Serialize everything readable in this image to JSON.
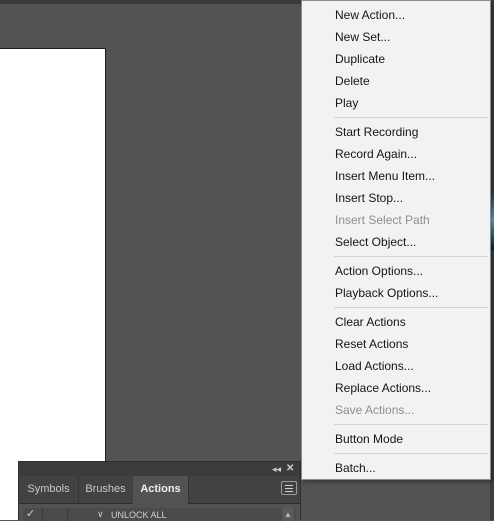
{
  "panel": {
    "tabs": [
      {
        "label": "Symbols"
      },
      {
        "label": "Brushes"
      },
      {
        "label": "Actions",
        "active": true
      }
    ],
    "action_row": {
      "label": "UNLOCK ALL",
      "checked": true
    }
  },
  "menu": {
    "items": [
      {
        "label": "New Action...",
        "enabled": true
      },
      {
        "label": "New Set...",
        "enabled": true
      },
      {
        "label": "Duplicate",
        "enabled": true
      },
      {
        "label": "Delete",
        "enabled": true
      },
      {
        "label": "Play",
        "enabled": true
      },
      {
        "label": "Start Recording",
        "enabled": true
      },
      {
        "label": "Record Again...",
        "enabled": true
      },
      {
        "label": "Insert Menu Item...",
        "enabled": true
      },
      {
        "label": "Insert Stop...",
        "enabled": true
      },
      {
        "label": "Insert Select Path",
        "enabled": false
      },
      {
        "label": "Select Object...",
        "enabled": true
      },
      {
        "label": "Action Options...",
        "enabled": true
      },
      {
        "label": "Playback Options...",
        "enabled": true
      },
      {
        "label": "Clear Actions",
        "enabled": true
      },
      {
        "label": "Reset Actions",
        "enabled": true
      },
      {
        "label": "Load Actions...",
        "enabled": true
      },
      {
        "label": "Replace Actions...",
        "enabled": true
      },
      {
        "label": "Save Actions...",
        "enabled": false
      },
      {
        "label": "Button Mode",
        "enabled": true
      },
      {
        "label": "Batch...",
        "enabled": true
      }
    ]
  }
}
